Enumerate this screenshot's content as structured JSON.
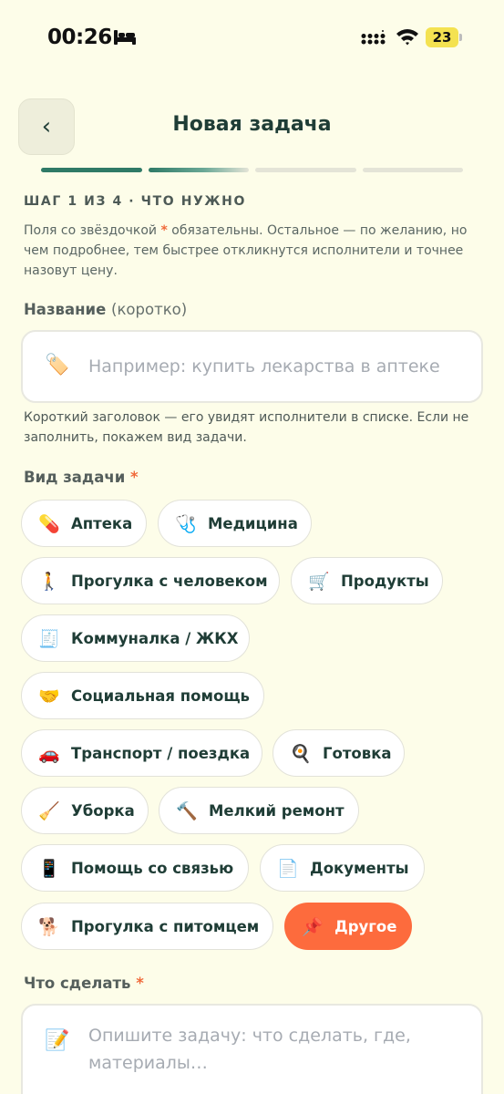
{
  "status": {
    "time": "00:26",
    "battery": "23"
  },
  "header": {
    "back_label": "‹",
    "title": "Новая задача"
  },
  "progress": {
    "total": 4,
    "current": 1,
    "segments": [
      "done",
      "half",
      "todo",
      "todo"
    ]
  },
  "step": {
    "label": "ШАГ 1 ИЗ 4 · ЧТО НУЖНО"
  },
  "hint": {
    "before": "Поля со звёздочкой ",
    "star": "*",
    "after": " обязательны. Остальное — по желанию, но чем подробнее, тем быстрее откликнутся исполнители и точнее назовут цену."
  },
  "title_field": {
    "label": "Название",
    "sublabel": "(коротко)",
    "icon": "🏷️",
    "placeholder": "Например: купить лекарства в аптеке",
    "help": "Короткий заголовок — его увидят исполнители в списке. Если не заполнить, покажем вид задачи."
  },
  "category": {
    "label": "Вид задачи",
    "required": "*",
    "selected": "Другое",
    "items": [
      {
        "icon": "💊",
        "label": "Аптека"
      },
      {
        "icon": "🩺",
        "label": "Медицина"
      },
      {
        "icon": "🚶",
        "label": "Прогулка с человеком"
      },
      {
        "icon": "🛒",
        "label": "Продукты"
      },
      {
        "icon": "🧾",
        "label": "Коммуналка / ЖКХ"
      },
      {
        "icon": "🤝",
        "label": "Социальная помощь"
      },
      {
        "icon": "🚗",
        "label": "Транспорт / поездка"
      },
      {
        "icon": "🍳",
        "label": "Готовка"
      },
      {
        "icon": "🧹",
        "label": "Уборка"
      },
      {
        "icon": "🔨",
        "label": "Мелкий ремонт"
      },
      {
        "icon": "📱",
        "label": "Помощь со связью"
      },
      {
        "icon": "📄",
        "label": "Документы"
      },
      {
        "icon": "🐕",
        "label": "Прогулка с питомцем"
      },
      {
        "icon": "📌",
        "label": "Другое"
      }
    ]
  },
  "task_field": {
    "label": "Что сделать",
    "required": "*",
    "icon": "📝",
    "placeholder": "Опишите задачу: что сделать, где, материалы…"
  },
  "colors": {
    "accent": "#fd6b3d",
    "primary": "#2f7a66",
    "background": "#fdfde9",
    "text": "#1f3d36"
  }
}
